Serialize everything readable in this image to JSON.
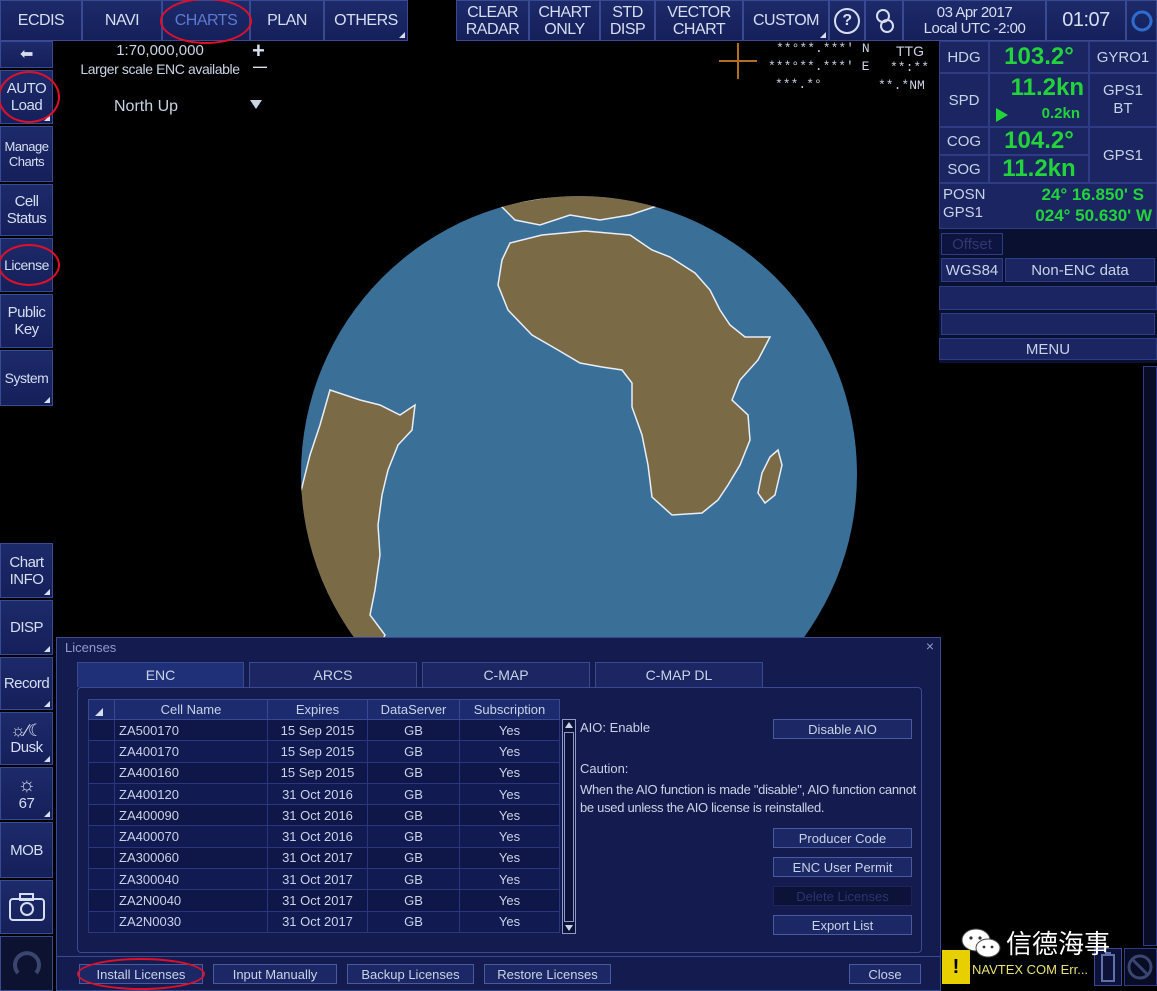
{
  "topbar": {
    "left_tabs": [
      "ECDIS",
      "NAVI",
      "CHARTS",
      "PLAN",
      "OTHERS"
    ],
    "right_buttons": [
      "CLEAR\nRADAR",
      "CHART\nONLY",
      "STD\nDISP",
      "VECTOR\nCHART",
      "CUSTOM"
    ],
    "help_label": "?",
    "date": "03 Apr 2017",
    "tz": "Local UTC -2:00",
    "time": "01:07"
  },
  "chart_header": {
    "scale": "1:70,000,000",
    "scale_note": "Larger scale ENC available",
    "orientation": "North Up",
    "zoom_in": "+",
    "zoom_out": "—"
  },
  "cursor_readout": {
    "lat": "**°**.***' N",
    "lon": "***°**.***' E",
    "brg": "***.*°",
    "ttg_label": "TTG",
    "ttg": "**:**",
    "rng": "**.*NM"
  },
  "left_sidebar": {
    "back": "⬅",
    "items": [
      "AUTO\nLoad",
      "Manage\nCharts",
      "Cell\nStatus",
      "License",
      "Public\nKey",
      "System"
    ],
    "lower_items": [
      "Chart\nINFO",
      "DISP",
      "Record",
      "Dusk",
      "67",
      "MOB"
    ]
  },
  "nav_data": {
    "hdg_label": "HDG",
    "hdg": "103.2°",
    "hdg_src": "GYRO1",
    "spd_label": "SPD",
    "spd": "11.2kn",
    "spd_sub": "0.2kn",
    "spd_src": "GPS1\nBT",
    "cog_label": "COG",
    "cog": "104.2°",
    "sog_label": "SOG",
    "sog": "11.2kn",
    "cog_src": "GPS1",
    "posn_label": "POSN\nGPS1",
    "lat": "24° 16.850' S",
    "lon": "024° 50.630' W",
    "offset": "Offset",
    "datum": "WGS84",
    "enc_status": "Non-ENC data",
    "menu": "MENU"
  },
  "dialog": {
    "title": "Licenses",
    "close_x": "×",
    "tabs": [
      "ENC",
      "ARCS",
      "C-MAP",
      "C-MAP DL"
    ],
    "columns": [
      "Cell Name",
      "Expires",
      "DataServer",
      "Subscription"
    ],
    "rows": [
      [
        "ZA500170",
        "15 Sep 2015",
        "GB",
        "Yes"
      ],
      [
        "ZA400170",
        "15 Sep 2015",
        "GB",
        "Yes"
      ],
      [
        "ZA400160",
        "15 Sep 2015",
        "GB",
        "Yes"
      ],
      [
        "ZA400120",
        "31 Oct 2016",
        "GB",
        "Yes"
      ],
      [
        "ZA400090",
        "31 Oct 2016",
        "GB",
        "Yes"
      ],
      [
        "ZA400070",
        "31 Oct 2016",
        "GB",
        "Yes"
      ],
      [
        "ZA300060",
        "31 Oct 2017",
        "GB",
        "Yes"
      ],
      [
        "ZA300040",
        "31 Oct 2017",
        "GB",
        "Yes"
      ],
      [
        "ZA2N0040",
        "31 Oct 2017",
        "GB",
        "Yes"
      ],
      [
        "ZA2N0030",
        "31 Oct 2017",
        "GB",
        "Yes"
      ]
    ],
    "aio_status": "AIO:  Enable",
    "disable_aio": "Disable AIO",
    "caution_title": "Caution:",
    "caution_text": "When the AIO function is made \"disable\", AIO function cannot be used unless the AIO license is reinstalled.",
    "producer_code": "Producer Code",
    "enc_user_permit": "ENC User Permit",
    "delete_licenses": "Delete Licenses",
    "export_list": "Export List",
    "bottom_buttons": [
      "Install Licenses",
      "Input Manually",
      "Backup Licenses",
      "Restore Licenses"
    ],
    "close": "Close"
  },
  "status": {
    "alert_icon": "!",
    "alert_text": "NAVTEX COM Err...",
    "watermark": "信德海事"
  },
  "colors": {
    "button_bg": "#1a2562",
    "accent_green": "#22d43a",
    "highlight_red": "#e0102a",
    "sea": "#3a6f98",
    "land": "#7a6a45"
  }
}
